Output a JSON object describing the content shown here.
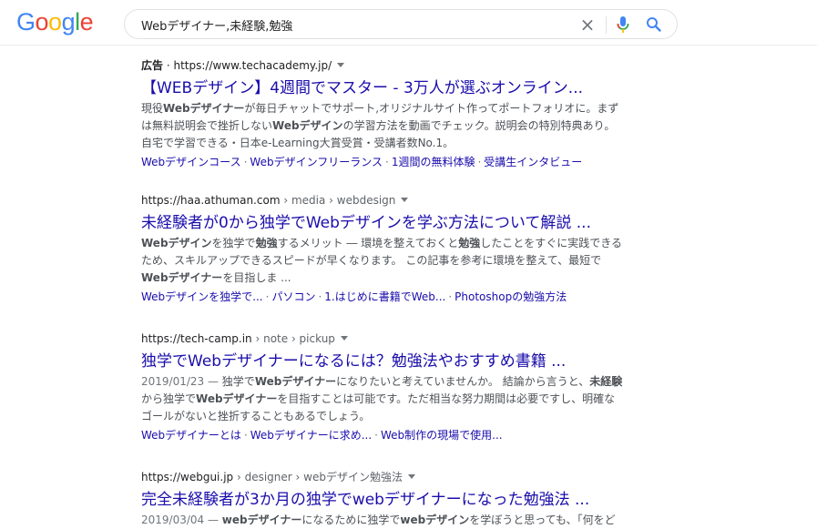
{
  "logo": {
    "letters": [
      "G",
      "o",
      "o",
      "g",
      "l",
      "e"
    ],
    "colors": [
      "#4285f4",
      "#ea4335",
      "#fbbc05",
      "#4285f4",
      "#34a853",
      "#ea4335"
    ]
  },
  "search": {
    "query": "Webデザイナー,未経験,勉強",
    "clear_icon": "×"
  },
  "results": [
    {
      "ad_label": "広告",
      "url": "https://www.techacademy.jp/",
      "title": "【WEBデザイン】4週間でマスター - 3万人が選ぶオンライン...",
      "snippet": [
        {
          "t": "現役",
          "b": false
        },
        {
          "t": "Webデザイナー",
          "b": true
        },
        {
          "t": "が毎日チャットでサポート,オリジナルサイト作ってポートフォリオに。まずは無料説明会で挫折しない",
          "b": false
        },
        {
          "t": "Webデザイン",
          "b": true
        },
        {
          "t": "の学習方法を動画でチェック。説明会の特別特典あり。自宅で学習できる・日本e-Learning大賞受賞・受講者数No.1。",
          "b": false
        }
      ],
      "sitelinks": [
        "Webデザインコース",
        "Webデザインフリーランス",
        "1週間の無料体験",
        "受講生インタビュー"
      ]
    },
    {
      "url": "https://haa.athuman.com",
      "crumbs": "› media › webdesign",
      "title": "未経験者が0から独学でWebデザインを学ぶ方法について解説 ...",
      "snippet": [
        {
          "t": "Webデザイン",
          "b": true
        },
        {
          "t": "を独学で",
          "b": false
        },
        {
          "t": "勉強",
          "b": true
        },
        {
          "t": "するメリット ― 環境を整えておくと",
          "b": false
        },
        {
          "t": "勉強",
          "b": true
        },
        {
          "t": "したことをすぐに実践できるため、スキルアップできるスピードが早くなります。 この記事を参考に環境を整えて、最短で",
          "b": false
        },
        {
          "t": "Webデザイナー",
          "b": true
        },
        {
          "t": "を目指しま ...",
          "b": false
        }
      ],
      "sitelinks": [
        "Webデザインを独学で...",
        "パソコン",
        "1.はじめに書籍でWeb...",
        "Photoshopの勉強方法"
      ]
    },
    {
      "url": "https://tech-camp.in",
      "crumbs": "› note › pickup",
      "title": "独学でWebデザイナーになるには？勉強法やおすすめ書籍 ...",
      "date": "2019/01/23 — ",
      "snippet": [
        {
          "t": "独学で",
          "b": false
        },
        {
          "t": "Webデザイナー",
          "b": true
        },
        {
          "t": "になりたいと考えていませんか。 結論から言うと、",
          "b": false
        },
        {
          "t": "未経験",
          "b": true
        },
        {
          "t": "から独学で",
          "b": false
        },
        {
          "t": "Webデザイナー",
          "b": true
        },
        {
          "t": "を目指すことは可能です。ただ相当な努力期間は必要ですし、明確なゴールがないと挫折することもあるでしょう。",
          "b": false
        }
      ],
      "sitelinks": [
        "Webデザイナーとは",
        "Webデザイナーに求め...",
        "Web制作の現場で使用..."
      ]
    },
    {
      "url": "https://webgui.jp",
      "crumbs": "› designer › webデザイン勉強法",
      "title": "完全未経験者が3か月の独学でwebデザイナーになった勉強法 ...",
      "date": "2019/03/04 — ",
      "snippet": [
        {
          "t": "webデザイナー",
          "b": true
        },
        {
          "t": "になるために独学で",
          "b": false
        },
        {
          "t": "webデザイン",
          "b": true
        },
        {
          "t": "を学ぼうと思っても、「何をど",
          "b": false
        }
      ],
      "sitelinks": []
    }
  ]
}
